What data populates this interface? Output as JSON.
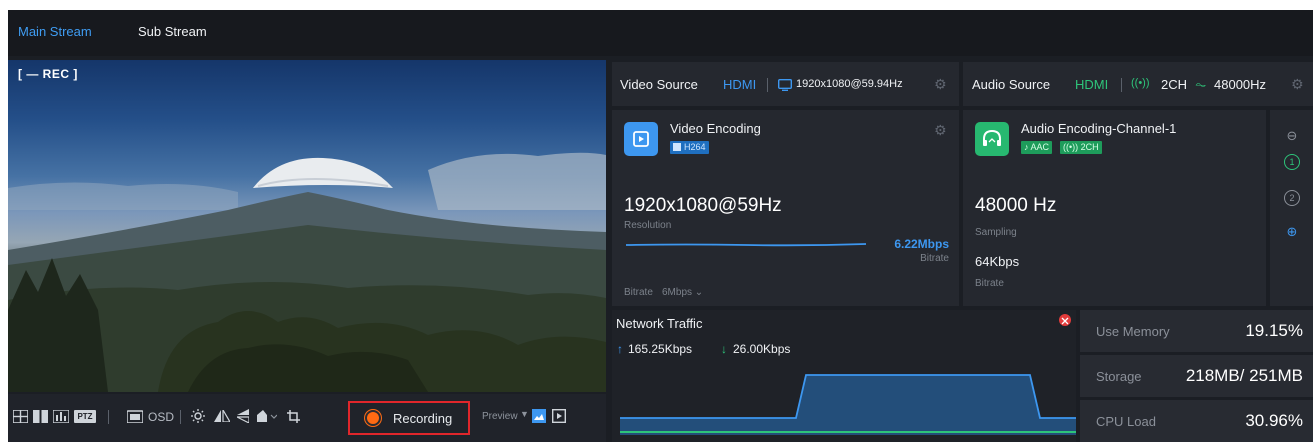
{
  "tabs": [
    {
      "label": "Main Stream",
      "active": true
    },
    {
      "label": "Sub Stream",
      "active": false
    }
  ],
  "preview": {
    "rec_label": "[ — REC ]"
  },
  "toolbar": {
    "osd_label": "OSD",
    "recording_label": "Recording",
    "preview_label": "Preview",
    "ptz_label": "PTZ"
  },
  "video_source": {
    "label": "Video Source",
    "interface": "HDMI",
    "resolution": "1920x1080@59.94Hz"
  },
  "audio_source": {
    "label": "Audio Source",
    "interface": "HDMI",
    "channels": "2CH",
    "sample_rate": "48000Hz"
  },
  "video_encoding": {
    "title": "Video Encoding",
    "codec": "H264",
    "resolution_value": "1920x1080@59Hz",
    "resolution_label": "Resolution",
    "bitrate_value": "6.22Mbps",
    "bitrate_caption": "Bitrate",
    "bitrate_label": "Bitrate",
    "bitrate_setting": "6Mbps"
  },
  "audio_encoding": {
    "title": "Audio Encoding-Channel-1",
    "codec": "AAC",
    "channels": "2CH",
    "sampling_value": "48000 Hz",
    "sampling_label": "Sampling",
    "bitrate_value": "64Kbps",
    "bitrate_label": "Bitrate",
    "channel_buttons": [
      "1",
      "2"
    ]
  },
  "network": {
    "title": "Network Traffic",
    "upload": "165.25Kbps",
    "download": "26.00Kbps"
  },
  "stats": [
    {
      "label": "Use Memory",
      "value": "19.15%"
    },
    {
      "label": "Storage",
      "value": "218MB/ 251MB"
    },
    {
      "label": "CPU Load",
      "value": "30.96%"
    }
  ],
  "colors": {
    "accent_blue": "#3d97f0",
    "accent_green": "#2ec47a",
    "record_border": "#e0262b",
    "record_dot": "#ff6a13",
    "panel_bg": "#25282f"
  },
  "icons": {
    "video_source": "monitor-icon",
    "audio_channels": "audio-wave-icon",
    "sample_rate": "pulse-icon",
    "video_encoding": "play-square-icon",
    "audio_encoding": "headphones-icon",
    "network_alert": "red-alert-icon"
  }
}
